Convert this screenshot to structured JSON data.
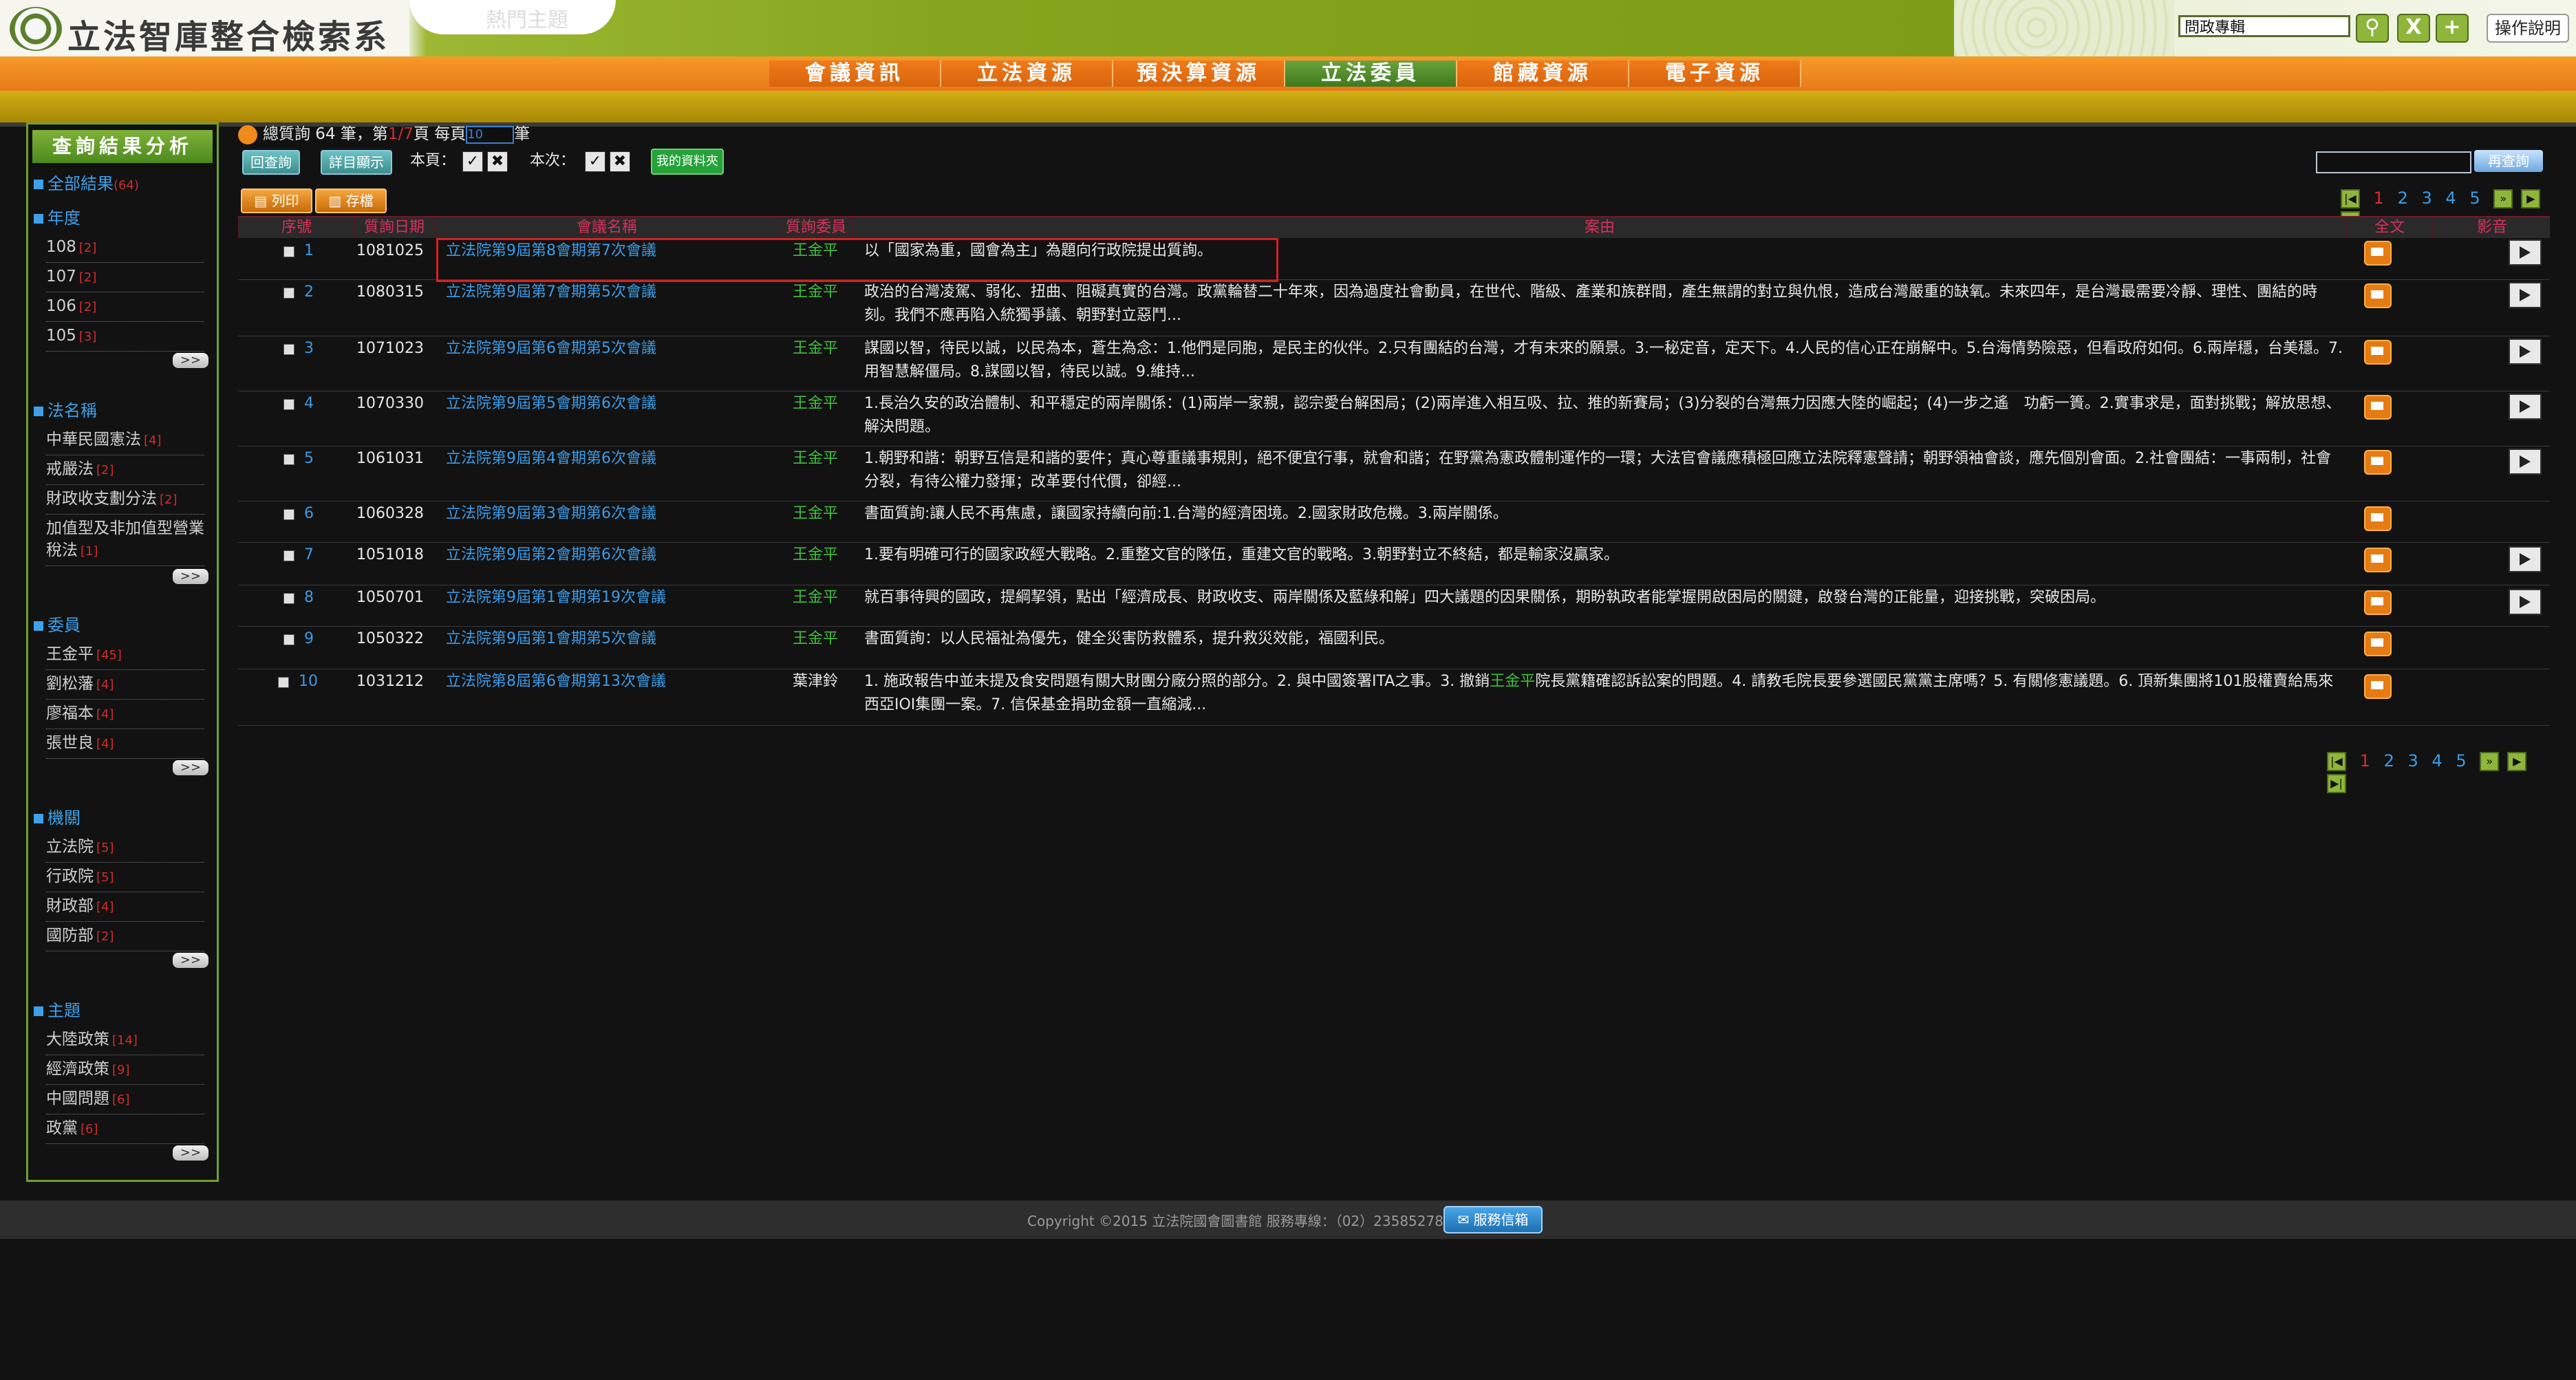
{
  "header": {
    "site_title": "立法智庫整合檢索系統",
    "hot_topic": "熱門主題",
    "search_value": "問政專輯",
    "search_icon": "magnifier-icon",
    "clear_label": "X",
    "add_label": "+",
    "help_label": "操作說明"
  },
  "nav": {
    "items": [
      "會議資訊",
      "立法資源",
      "預決算資源",
      "立法委員",
      "館藏資源",
      "電子資源"
    ],
    "active_index": 3
  },
  "sidebar": {
    "title": "查詢結果分析",
    "all_results_label": "全部結果",
    "all_results_count": "(64)",
    "sections": [
      {
        "title": "年度",
        "items": [
          {
            "label": "108",
            "count": "[2]"
          },
          {
            "label": "107",
            "count": "[2]"
          },
          {
            "label": "106",
            "count": "[2]"
          },
          {
            "label": "105",
            "count": "[3]"
          }
        ]
      },
      {
        "title": "法名稱",
        "items": [
          {
            "label": "中華民國憲法",
            "count": "[4]"
          },
          {
            "label": "戒嚴法",
            "count": "[2]"
          },
          {
            "label": "財政收支劃分法",
            "count": "[2]"
          },
          {
            "label": "加值型及非加值型營業稅法",
            "count": "[1]"
          }
        ]
      },
      {
        "title": "委員",
        "items": [
          {
            "label": "王金平",
            "count": "[45]"
          },
          {
            "label": "劉松藩",
            "count": "[4]"
          },
          {
            "label": "廖福本",
            "count": "[4]"
          },
          {
            "label": "張世良",
            "count": "[4]"
          }
        ]
      },
      {
        "title": "機關",
        "items": [
          {
            "label": "立法院",
            "count": "[5]"
          },
          {
            "label": "行政院",
            "count": "[5]"
          },
          {
            "label": "財政部",
            "count": "[4]"
          },
          {
            "label": "國防部",
            "count": "[2]"
          }
        ]
      },
      {
        "title": "主題",
        "items": [
          {
            "label": "大陸政策",
            "count": "[14]"
          },
          {
            "label": "經濟政策",
            "count": "[9]"
          },
          {
            "label": "中國問題",
            "count": "[6]"
          },
          {
            "label": "政黨",
            "count": "[6]"
          }
        ]
      }
    ],
    "more_label": ">>"
  },
  "toolbar": {
    "summary_prefix": "總質詢 64 筆，第",
    "summary_page": "1/7",
    "summary_mid": "頁  每頁",
    "per_page_value": "10",
    "summary_suffix": "筆",
    "back_label": "回查詢",
    "detail_label": "詳目顯示",
    "this_page_label": "本頁：",
    "this_time_label": "本次：",
    "my_resource_label": "我的資料夾",
    "research_label": "再查詢",
    "print_label": "列印",
    "save_label": "存檔"
  },
  "pager": {
    "pages": [
      "1",
      "2",
      "3",
      "4",
      "5"
    ],
    "current": "1",
    "first_icon": "first-page-icon",
    "next_icon": "next-page-icon",
    "last_icon": "last-page-icon"
  },
  "table": {
    "headers": [
      "序號",
      "質詢日期",
      "會議名稱",
      "質詢委員",
      "案由",
      "全文",
      "影音"
    ],
    "rows": [
      {
        "no": "1",
        "date": "1081025",
        "meeting": "立法院第9屆第8會期第7次會議",
        "member": "王金平",
        "cause": "以「國家為重，國會為主」為題向行政院提出質詢。",
        "video": true
      },
      {
        "no": "2",
        "date": "1080315",
        "meeting": "立法院第9屆第7會期第5次會議",
        "member": "王金平",
        "cause": "政治的台灣凌駕、弱化、扭曲、阻礙真實的台灣。政黨輪替二十年來，因為過度社會動員，在世代、階級、產業和族群間，產生無謂的對立與仇恨，造成台灣嚴重的缺氧。未來四年，是台灣最需要冷靜、理性、團結的時刻。我們不應再陷入統獨爭議、朝野對立惡鬥...",
        "video": true
      },
      {
        "no": "3",
        "date": "1071023",
        "meeting": "立法院第9屆第6會期第5次會議",
        "member": "王金平",
        "cause": "謀國以智，待民以誠，以民為本，蒼生為念：1.他們是同胞，是民主的伙伴。2.只有團結的台灣，才有未來的願景。3.一秘定音，定天下。4.人民的信心正在崩解中。5.台海情勢險惡，但看政府如何。6.兩岸穩，台美穩。7.用智慧解僵局。8.謀國以智，待民以誠。9.維持...",
        "video": true
      },
      {
        "no": "4",
        "date": "1070330",
        "meeting": "立法院第9屆第5會期第6次會議",
        "member": "王金平",
        "cause": "1.長治久安的政治體制、和平穩定的兩岸關係：(1)兩岸一家親，認宗愛台解困局；(2)兩岸進入相互吸、拉、推的新賽局；(3)分裂的台灣無力因應大陸的崛起；(4)一步之遙　功虧一簣。2.實事求是，面對挑戰；解放思想、解決問題。",
        "video": true
      },
      {
        "no": "5",
        "date": "1061031",
        "meeting": "立法院第9屆第4會期第6次會議",
        "member": "王金平",
        "cause": "1.朝野和諧：朝野互信是和諧的要件；真心尊重議事規則，絕不便宜行事，就會和諧；在野黨為憲政體制運作的一環；大法官會議應積極回應立法院釋憲聲請；朝野領袖會談，應先個別會面。2.社會團結：一事兩制，社會分裂，有待公權力發揮；改革要付代價，卻經...",
        "video": true
      },
      {
        "no": "6",
        "date": "1060328",
        "meeting": "立法院第9屆第3會期第6次會議",
        "member": "王金平",
        "cause": "書面質詢:讓人民不再焦慮，讓國家持續向前:1.台灣的經濟困境。2.國家財政危機。3.兩岸關係。",
        "video": false
      },
      {
        "no": "7",
        "date": "1051018",
        "meeting": "立法院第9屆第2會期第6次會議",
        "member": "王金平",
        "cause": "1.要有明確可行的國家政經大戰略。2.重整文官的隊伍，重建文官的戰略。3.朝野對立不終結，都是輸家沒贏家。",
        "video": true
      },
      {
        "no": "8",
        "date": "1050701",
        "meeting": "立法院第9屆第1會期第19次會議",
        "member": "王金平",
        "cause": "就百事待興的國政，提綱挈領，點出「經濟成長、財政收支、兩岸關係及藍綠和解」四大議題的因果關係，期盼執政者能掌握開啟困局的關鍵，啟發台灣的正能量，迎接挑戰，突破困局。",
        "video": true
      },
      {
        "no": "9",
        "date": "1050322",
        "meeting": "立法院第9屆第1會期第5次會議",
        "member": "王金平",
        "cause": "書面質詢：以人民福祉為優先，健全災害防救體系，提升救災效能，福國利民。",
        "video": false
      },
      {
        "no": "10",
        "date": "1031212",
        "meeting": "立法院第8屆第6會期第13次會議",
        "member": "葉津鈴",
        "cause_prefix": "1. 施政報告中並未提及食安問題有關大財團分廠分照的部分。2. 與中國簽署ITA之事。3. 撤銷",
        "cause_hl": "王金平",
        "cause_suffix": "院長黨籍確認訴訟案的問題。4. 請教毛院長要參選國民黨黨主席嗎？5. 有關修憲議題。6. 頂新集團將101股權賣給馬來西亞IOI集團一案。7. 信保基金捐助金額一直縮減...",
        "video": false
      }
    ],
    "pdf_icon": "pdf-document-icon",
    "video_icon": "video-play-icon"
  },
  "footer": {
    "text": "Copyright ©2015  立法院國會圖書館  服務專線：（02）23585278",
    "mail_label": "服務信箱"
  }
}
